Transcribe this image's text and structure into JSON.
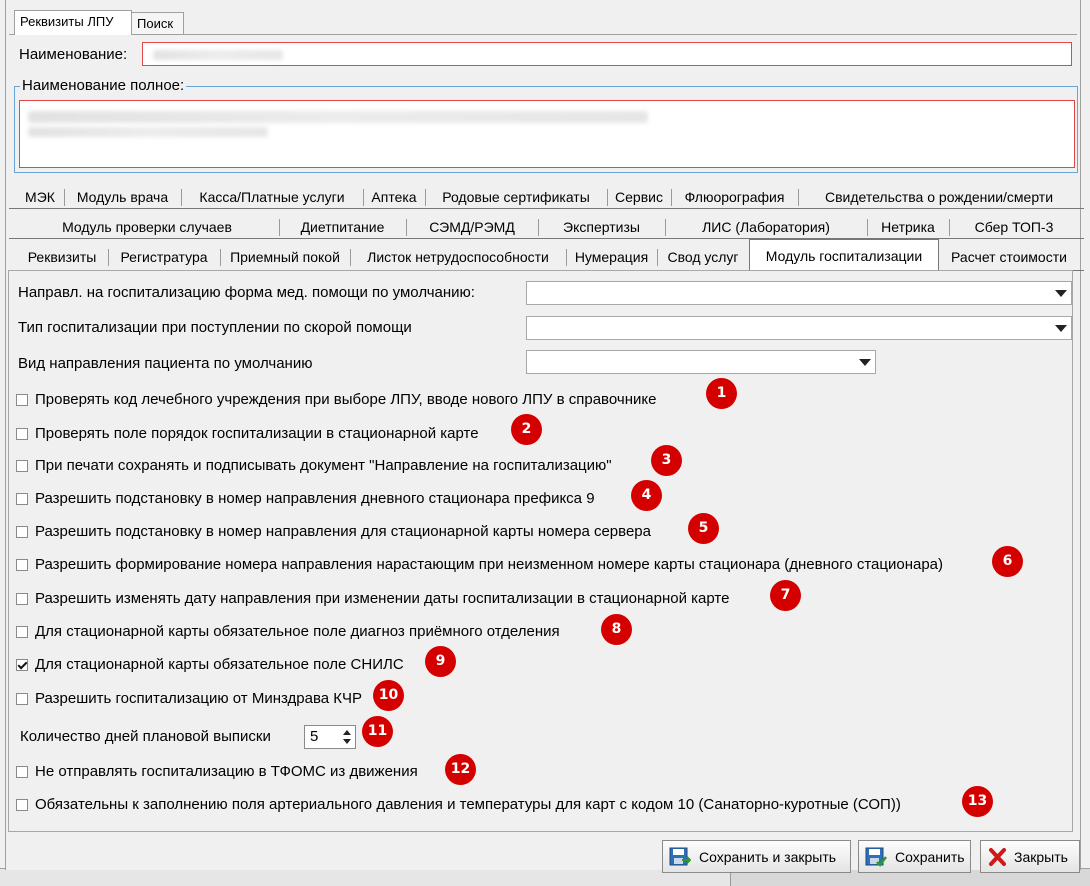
{
  "top_tabs": [
    "Реквизиты ЛПУ",
    "Поиск"
  ],
  "name_label": "Наименование:",
  "fullname_label": "Наименование полное:",
  "tab_row1": [
    "МЭК",
    "Модуль врача",
    "Касса/Платные услуги",
    "Аптека",
    "Родовые сертификаты",
    "Сервис",
    "Флюорография",
    "Свидетельства о рождении/смерти"
  ],
  "tab_row2": [
    "Модуль проверки случаев",
    "Диетпитание",
    "СЭМД/РЭМД",
    "Экспертизы",
    "ЛИС (Лаборатория)",
    "Нетрика",
    "Сбер ТОП-3"
  ],
  "tab_row3": [
    "Реквизиты",
    "Регистратура",
    "Приемный покой",
    "Листок нетрудоспособности",
    "Нумерация",
    "Свод услуг",
    "Модуль госпитализации",
    "Расчет стоимости"
  ],
  "active_tab": "Модуль госпитализации",
  "fields": [
    {
      "label": "Направл. на госпитализацию форма мед. помощи по умолчанию:",
      "value": ""
    },
    {
      "label": "Тип госпитализации при поступлении по скорой помощи",
      "value": ""
    },
    {
      "label": "Вид направления пациента по умолчанию",
      "value": ""
    }
  ],
  "checkboxes": [
    {
      "label": "Проверять код лечебного учреждения при выборе ЛПУ, вводе нового ЛПУ в справочнике",
      "checked": false,
      "badge": "1"
    },
    {
      "label": "Проверять поле порядок госпитализации в стационарной карте",
      "checked": false,
      "badge": "2"
    },
    {
      "label": "При печати сохранять и подписывать документ \"Направление на госпитализацию\"",
      "checked": false,
      "badge": "3"
    },
    {
      "label": "Разрешить подстановку в номер направления дневного стационара префикса 9",
      "checked": false,
      "badge": "4"
    },
    {
      "label": "Разрешить подстановку в номер направления для стационарной карты номера сервера",
      "checked": false,
      "badge": "5"
    },
    {
      "label": "Разрешить формирование номера направления нарастающим при неизменном номере карты стационара (дневного стационара)",
      "checked": false,
      "badge": "6"
    },
    {
      "label": "Разрешить изменять дату направления при изменении даты госпитализации в стационарной карте",
      "checked": false,
      "badge": "7"
    },
    {
      "label": "Для стационарной карты обязательное поле диагноз приёмного отделения",
      "checked": false,
      "badge": "8"
    },
    {
      "label": "Для стационарной карты обязательное поле СНИЛС",
      "checked": true,
      "badge": "9"
    },
    {
      "label": "Разрешить госпитализацию от Минздрава КЧР",
      "checked": false,
      "badge": "10"
    }
  ],
  "days_field": {
    "label": "Количество дней плановой выписки",
    "value": "5",
    "badge": "11"
  },
  "checkboxes2": [
    {
      "label": "Не отправлять госпитализацию в ТФОМС из движения",
      "checked": false,
      "badge": "12"
    },
    {
      "label": "Обязательны к заполнению поля артериального давления и температуры для карт с кодом 10 (Санаторно-куротные (СОП))",
      "checked": false,
      "badge": "13"
    }
  ],
  "buttons": {
    "save_close": "Сохранить и закрыть",
    "save": "Сохранить",
    "close": "Закрыть"
  }
}
